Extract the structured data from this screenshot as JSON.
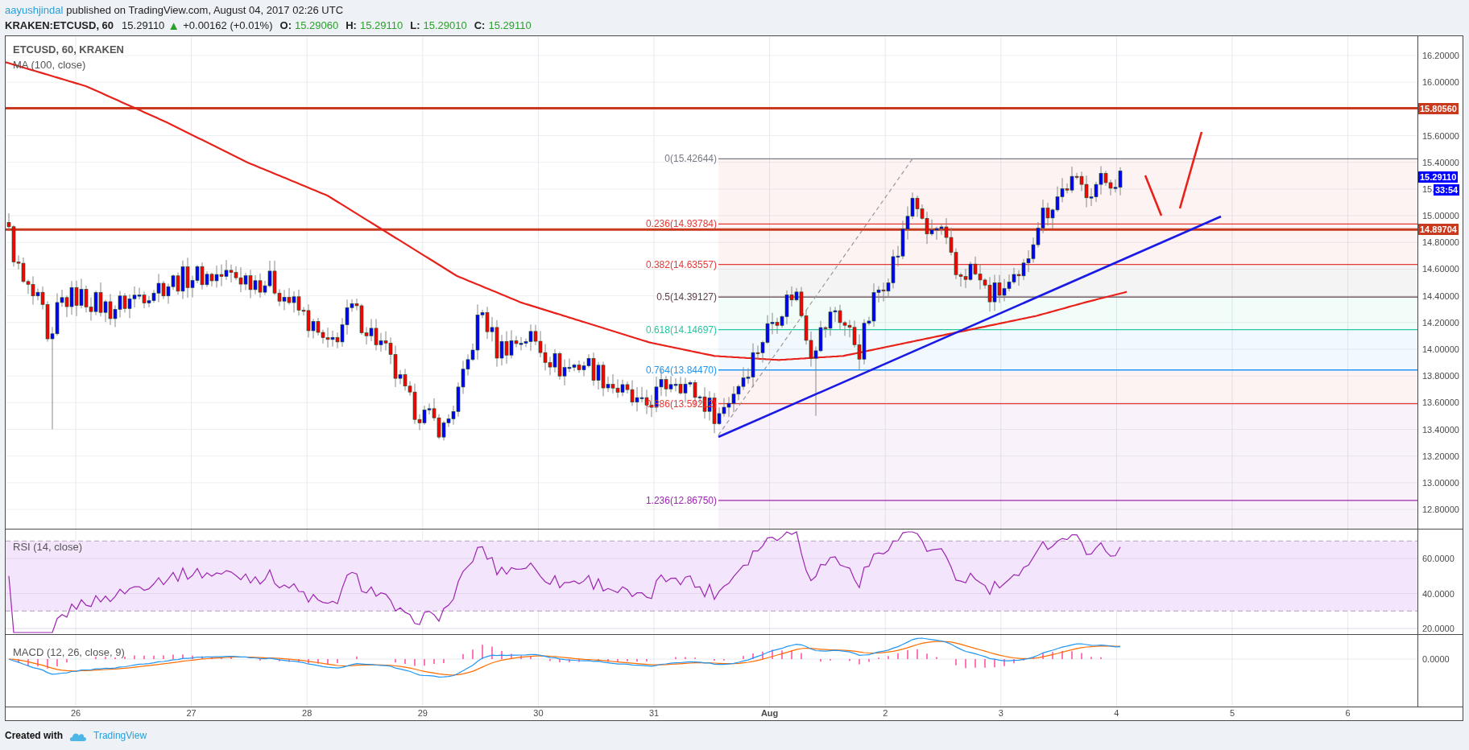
{
  "header": {
    "author": "aayushjindal",
    "published": "published on TradingView.com, August 04, 2017 02:26 UTC",
    "symbol": "KRAKEN:ETCUSD, 60",
    "last": "15.29110",
    "direction": "▲",
    "change": "+0.00162 (+0.01%)",
    "ohlc": [
      {
        "key": "O:",
        "value": "15.29060"
      },
      {
        "key": "H:",
        "value": "15.29110"
      },
      {
        "key": "L:",
        "value": "15.29010"
      },
      {
        "key": "C:",
        "value": "15.29110"
      }
    ]
  },
  "chart": {
    "legend": {
      "title": "ETCUSD, 60, KRAKEN",
      "indicator": "MA (100, close)"
    },
    "fib_levels": [
      {
        "label": "0(15.42644)",
        "color": "#787b86"
      },
      {
        "label": "0.236(14.93784)",
        "color": "#e53935"
      },
      {
        "label": "0.382(14.63557)",
        "color": "#e53935"
      },
      {
        "label": "0.5(14.39127)",
        "color": "#5d4048"
      },
      {
        "label": "0.618(14.14697)",
        "color": "#26c6a0"
      },
      {
        "label": "0.764(13.84470)",
        "color": "#2196f3"
      },
      {
        "label": "0.886(13.59212)",
        "color": "#e53935"
      },
      {
        "label": "1.236(12.86750)",
        "color": "#9c27b0"
      }
    ],
    "price_axis": [
      {
        "kind": "tick",
        "text": "16.20000"
      },
      {
        "kind": "tick",
        "text": "16.00000"
      },
      {
        "kind": "tag",
        "text": "15.80560",
        "color": "#c8391e"
      },
      {
        "kind": "tick",
        "text": "15.60000"
      },
      {
        "kind": "tick",
        "text": "15.40000"
      },
      {
        "kind": "tick",
        "text": "15."
      },
      {
        "kind": "tick",
        "text": "15.00000"
      },
      {
        "kind": "tick",
        "text": "14.80000"
      },
      {
        "kind": "tick",
        "text": "14.60000"
      },
      {
        "kind": "tick",
        "text": "14.40000"
      },
      {
        "kind": "tick",
        "text": "14.20000"
      },
      {
        "kind": "tick",
        "text": "14.00000"
      },
      {
        "kind": "tick",
        "text": "13.80000"
      },
      {
        "kind": "tick",
        "text": "13.60000"
      },
      {
        "kind": "tick",
        "text": "13.40000"
      },
      {
        "kind": "tick",
        "text": "13.20000"
      },
      {
        "kind": "tick",
        "text": "13.00000"
      },
      {
        "kind": "tick",
        "text": "12.80000"
      }
    ],
    "price_tags": [
      {
        "text": "15.29110",
        "color": "#0000ff"
      },
      {
        "text": "33:54",
        "color": "#0000ff"
      },
      {
        "text": "14.89704",
        "color": "#c8391e"
      }
    ],
    "rsi": {
      "legend": "RSI (14, close)",
      "axis": [
        "60.0000",
        "40.0000",
        "20.0000"
      ]
    },
    "macd": {
      "legend": "MACD (12, 26, close, 9)",
      "axis": [
        "0.0000"
      ]
    },
    "time_axis": [
      {
        "label": "26",
        "kind": "day"
      },
      {
        "label": "27",
        "kind": "day"
      },
      {
        "label": "28",
        "kind": "day"
      },
      {
        "label": "29",
        "kind": "day"
      },
      {
        "label": "30",
        "kind": "day"
      },
      {
        "label": "31",
        "kind": "day"
      },
      {
        "label": "Aug",
        "kind": "month"
      },
      {
        "label": "2",
        "kind": "day"
      },
      {
        "label": "3",
        "kind": "day"
      },
      {
        "label": "4",
        "kind": "day"
      },
      {
        "label": "5",
        "kind": "day"
      },
      {
        "label": "6",
        "kind": "day"
      }
    ]
  },
  "footer": {
    "created": "Created with",
    "brand": "TradingView"
  }
}
